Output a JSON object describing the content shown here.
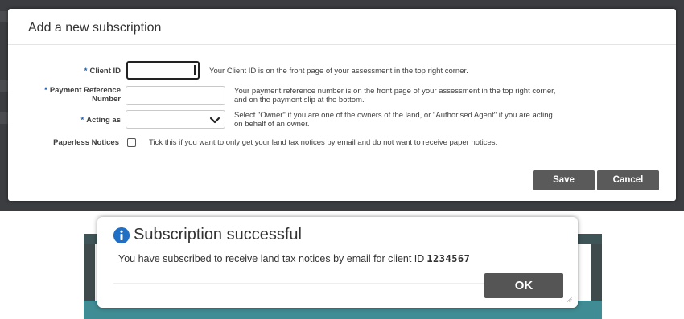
{
  "subscription_dialog": {
    "title": "Add a new subscription",
    "client_id": {
      "label": "Client ID",
      "value": "",
      "help": "Your Client ID is on the front page of your assessment in the top right corner."
    },
    "payment_reference": {
      "label_line1": "Payment Reference",
      "label_line2": "Number",
      "value": "",
      "help_line1": "Your payment reference number is on the front page of your assessment in the top right corner,",
      "help_line2": "and on the payment slip at the bottom."
    },
    "acting_as": {
      "label": "Acting as",
      "selected": "",
      "help_line1": "Select \"Owner\" if you are one of the owners of the land, or \"Authorised Agent\" if you are acting",
      "help_line2": "on behalf of an owner."
    },
    "paperless_notices": {
      "label": "Paperless Notices",
      "checked": false,
      "help": "Tick this if you want to only get your land tax notices by email and do not want to receive paper notices."
    },
    "required_marker": "*",
    "buttons": {
      "save": "Save",
      "cancel": "Cancel"
    }
  },
  "success_dialog": {
    "title": "Subscription successful",
    "message": "You have subscribed to receive land tax notices by email for client ID",
    "client_id": "1234567",
    "ok_label": "OK"
  },
  "icons": {
    "info": "info-circle-icon",
    "dropdown": "chevron-down-icon",
    "resize": "resize-grip-icon"
  },
  "colors": {
    "required_star": "#1f5fa8",
    "button_bg": "#5a5a5a",
    "info_icon": "#1f6fc5",
    "backdrop": "#3b3d40",
    "teal_footer": "#3f8c94"
  }
}
